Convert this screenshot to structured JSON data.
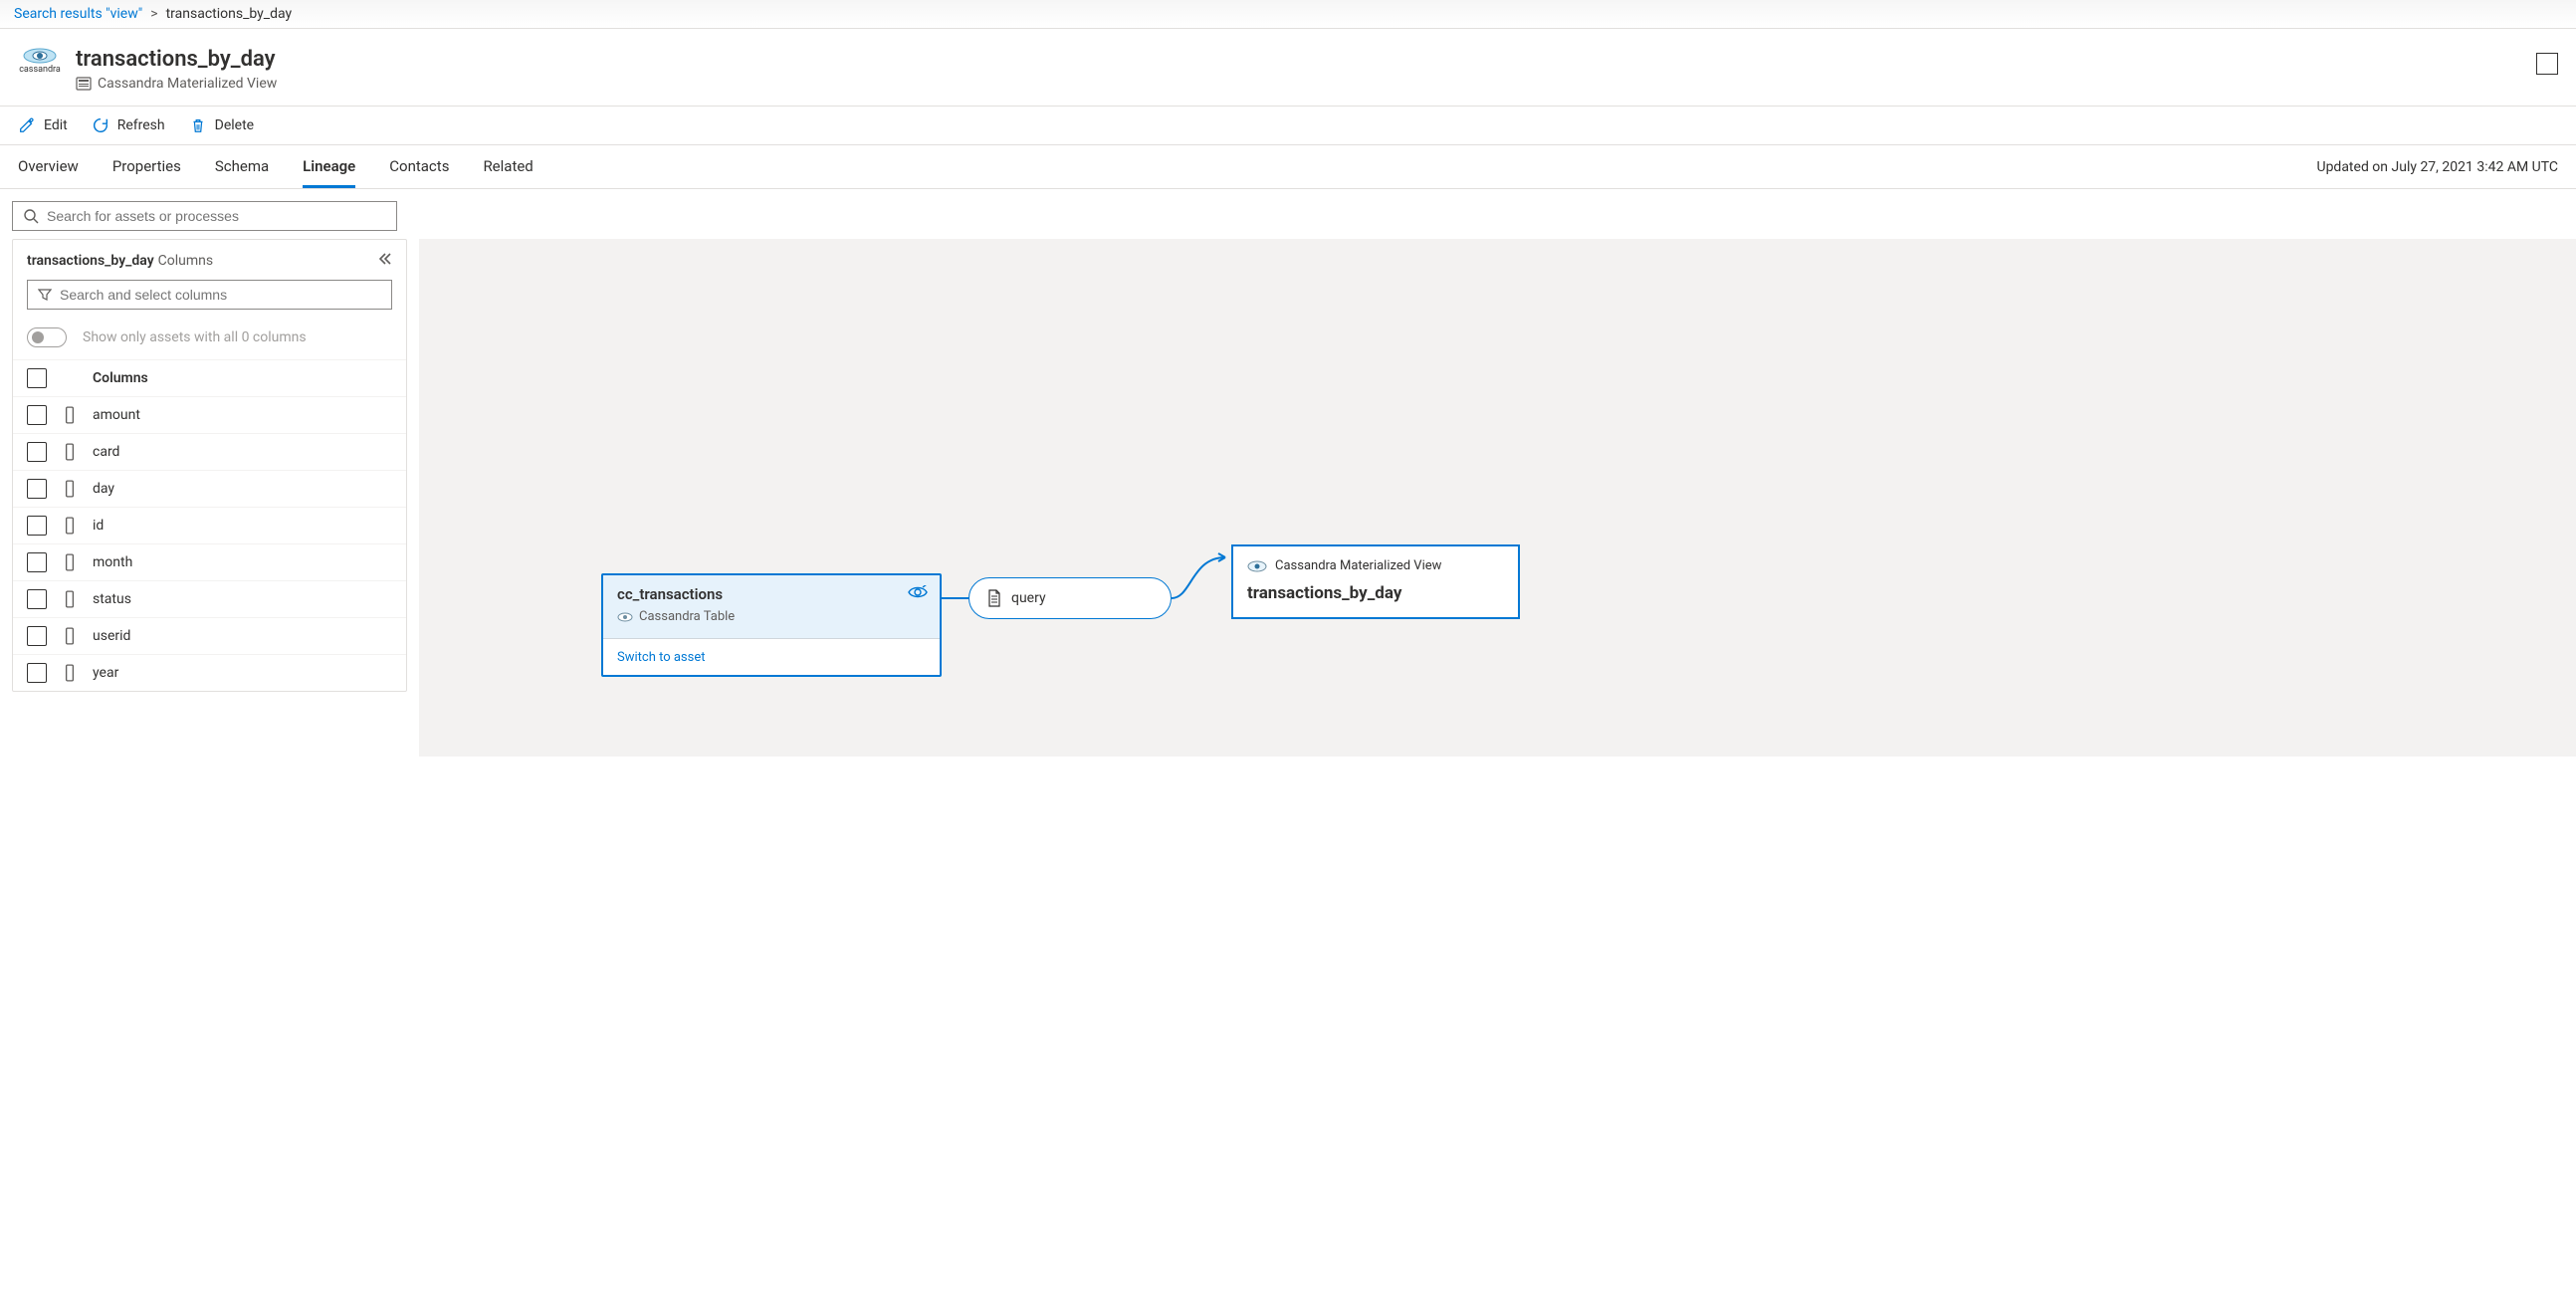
{
  "breadcrumb": {
    "back_label": "Search results \"view\"",
    "current": "transactions_by_day"
  },
  "header": {
    "title": "transactions_by_day",
    "subtype": "Cassandra Materialized View",
    "logo_caption": "cassandra"
  },
  "commands": {
    "edit": "Edit",
    "refresh": "Refresh",
    "delete": "Delete"
  },
  "tabs": {
    "items": [
      {
        "label": "Overview"
      },
      {
        "label": "Properties"
      },
      {
        "label": "Schema"
      },
      {
        "label": "Lineage"
      },
      {
        "label": "Contacts"
      },
      {
        "label": "Related"
      }
    ],
    "active_index": 3,
    "updated_text": "Updated on July 27, 2021 3:42 AM UTC"
  },
  "search": {
    "placeholder": "Search for assets or processes"
  },
  "side": {
    "title": "transactions_by_day",
    "subtitle": "Columns",
    "column_search_placeholder": "Search and select columns",
    "toggle_label": "Show only assets with all 0 columns",
    "header_label": "Columns",
    "columns": [
      {
        "name": "amount"
      },
      {
        "name": "card"
      },
      {
        "name": "day"
      },
      {
        "name": "id"
      },
      {
        "name": "month"
      },
      {
        "name": "status"
      },
      {
        "name": "userid"
      },
      {
        "name": "year"
      }
    ]
  },
  "lineage": {
    "source": {
      "title": "cc_transactions",
      "type": "Cassandra Table",
      "footer_link": "Switch to asset"
    },
    "process": {
      "label": "query"
    },
    "target": {
      "type": "Cassandra Materialized View",
      "title": "transactions_by_day"
    }
  }
}
